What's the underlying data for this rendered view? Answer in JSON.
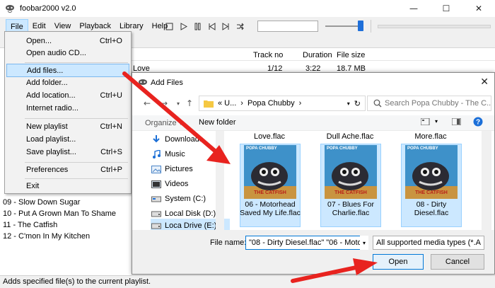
{
  "window": {
    "title": "foobar2000 v2.0",
    "minimize": "—",
    "maximize": "☐",
    "close": "✕"
  },
  "menubar": [
    "File",
    "Edit",
    "View",
    "Playback",
    "Library",
    "Help"
  ],
  "playlist": {
    "headers": {
      "track_no": "Track no",
      "duration": "Duration",
      "file_size": "File size"
    },
    "first_row": {
      "title": "Love",
      "track_no": "1/12",
      "duration": "3:22",
      "file_size": "18.7 MB"
    },
    "rows": [
      "09 - Slow Down Sugar",
      "10 - Put A Grown Man To Shame",
      "11 - The Catfish",
      "12 - C'mon In My Kitchen"
    ]
  },
  "file_menu": {
    "items": [
      {
        "label": "Open...",
        "shortcut": "Ctrl+O"
      },
      {
        "label": "Open audio CD...",
        "shortcut": ""
      },
      {
        "label": "Add files...",
        "shortcut": ""
      },
      {
        "label": "Add folder...",
        "shortcut": ""
      },
      {
        "label": "Add location...",
        "shortcut": "Ctrl+U"
      },
      {
        "label": "Internet radio...",
        "shortcut": ""
      },
      {
        "label": "New playlist",
        "shortcut": "Ctrl+N"
      },
      {
        "label": "Load playlist...",
        "shortcut": ""
      },
      {
        "label": "Save playlist...",
        "shortcut": "Ctrl+S"
      },
      {
        "label": "Preferences",
        "shortcut": "Ctrl+P"
      },
      {
        "label": "Exit",
        "shortcut": ""
      }
    ]
  },
  "dialog": {
    "title": "Add Files",
    "breadcrumb": [
      "« U...",
      "›",
      "Popa Chubby",
      "›"
    ],
    "search_placeholder": "Search Popa Chubby - The C...",
    "organize": "Organize ▾",
    "new_folder": "New folder",
    "nav_items": [
      "Downloads",
      "Music",
      "Pictures",
      "Videos",
      "System (C:)",
      "Local Disk (D:)",
      "Loca Drive (E:)"
    ],
    "files": [
      {
        "top_name": "Love.flac",
        "caption": "06 - Motorhead Saved My Life.flac"
      },
      {
        "top_name": "Dull Ache.flac",
        "caption": "07 - Blues For Charlie.flac"
      },
      {
        "top_name": "More.flac",
        "caption": "08 - Dirty Diesel.flac"
      }
    ],
    "album_art_text": {
      "top": "POPA CHUBBY",
      "bottom": "THE CATFISH"
    },
    "file_name_label": "File name:",
    "file_name_value": "\"08 - Dirty Diesel.flac\" \"06 - Motor",
    "file_type": "All supported media types (*.A",
    "open": "Open",
    "cancel": "Cancel"
  },
  "statusbar": "Adds specified file(s) to the current playlist.",
  "colors": {
    "highlight": "#cce8ff",
    "arrow": "#e8231f",
    "accent": "#0078d7"
  }
}
